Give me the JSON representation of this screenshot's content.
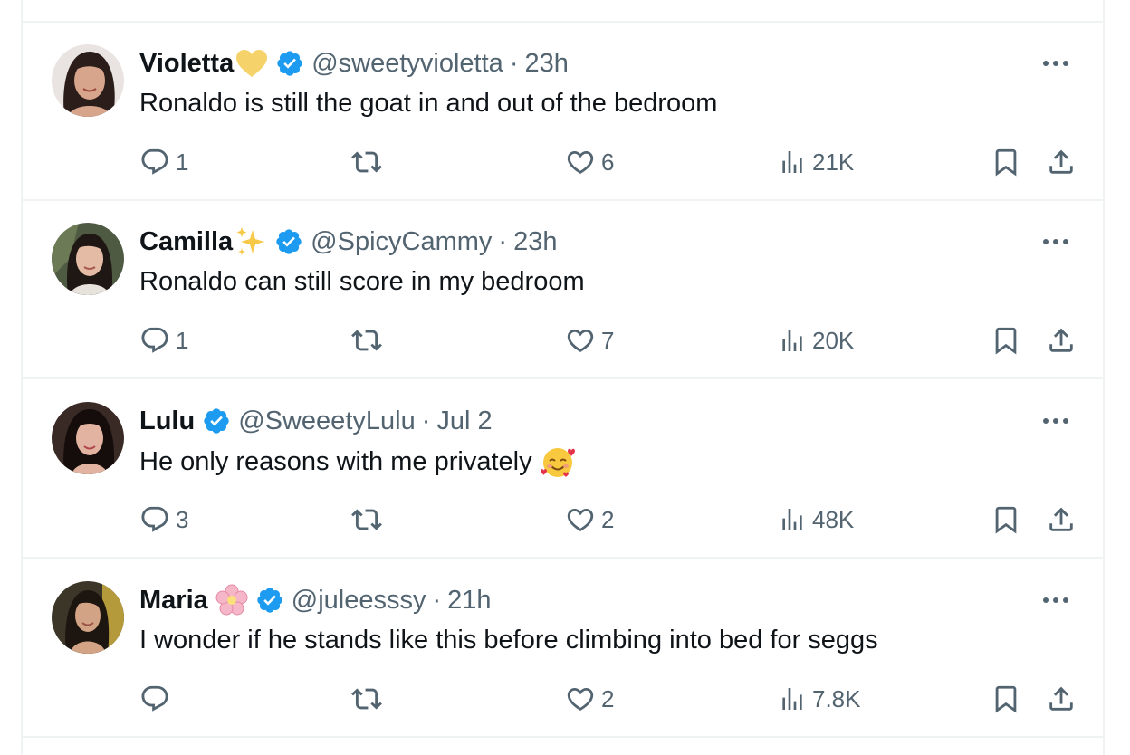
{
  "tweets": [
    {
      "name": "Violetta",
      "name_emoji": "yellow-heart",
      "handle": "@sweetyvioletta",
      "separator": "·",
      "time": "23h",
      "text": "Ronaldo is still the goat in and out of the bedroom",
      "text_emoji": "",
      "replies": "1",
      "retweets": "",
      "likes": "6",
      "views": "21K"
    },
    {
      "name": "Camilla",
      "name_emoji": "sparkles",
      "handle": "@SpicyCammy",
      "separator": "·",
      "time": "23h",
      "text": "Ronaldo can still score in my bedroom",
      "text_emoji": "",
      "replies": "1",
      "retweets": "",
      "likes": "7",
      "views": "20K"
    },
    {
      "name": "Lulu",
      "name_emoji": "",
      "handle": "@SweeetyLulu",
      "separator": "·",
      "time": "Jul 2",
      "text": "He only reasons with me privately",
      "text_emoji": "smiling-face-with-hearts",
      "replies": "3",
      "retweets": "",
      "likes": "2",
      "views": "48K"
    },
    {
      "name": "Maria",
      "name_emoji": "cherry-blossom",
      "handle": "@juleesssy",
      "separator": "·",
      "time": "21h",
      "text": "I wonder if he stands like this before climbing into bed for seggs",
      "text_emoji": "",
      "replies": "",
      "retweets": "",
      "likes": "2",
      "views": "7.8K"
    }
  ],
  "icons": {
    "verified": "verified-badge-icon",
    "more": "more-options-icon",
    "reply": "reply-icon",
    "retweet": "retweet-icon",
    "like": "heart-icon",
    "views": "views-chart-icon",
    "bookmark": "bookmark-icon",
    "share": "share-icon"
  },
  "colors": {
    "text": "#0f1419",
    "secondary": "#536471",
    "verified": "#1d9bf0",
    "divider": "#eff3f4"
  }
}
